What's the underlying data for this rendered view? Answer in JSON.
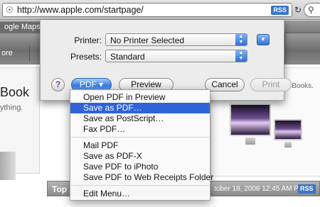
{
  "browser": {
    "url": "http://www.apple.com/startpage/",
    "rss_label": "RSS",
    "bookmarks": [
      "ogle Maps"
    ]
  },
  "page": {
    "nav_store": "ore",
    "left_title": "Book",
    "left_sub": "ything.",
    "promo_text": "precisely for the new MacBooks.",
    "top_sites_title": "Top S",
    "top_sites_date": "tober 18, 2008 12:45 AM PDT",
    "rss_label": "RSS"
  },
  "print_dialog": {
    "printer_label": "Printer:",
    "printer_value": "No Printer Selected",
    "presets_label": "Presets:",
    "presets_value": "Standard",
    "help_label": "?",
    "pdf_button": "PDF ▾",
    "preview_button": "Preview",
    "cancel_button": "Cancel",
    "print_button": "Print"
  },
  "pdf_menu": {
    "items": [
      "Open PDF in Preview",
      "Save as PDF…",
      "Save as PostScript…",
      "Fax PDF…",
      "Mail PDF",
      "Save as PDF-X",
      "Save PDF to iPhoto",
      "Save PDF to Web Receipts Folder",
      "Edit Menu…"
    ],
    "selected_index": 1
  },
  "colors": {
    "selection": "#2f63d8",
    "accent_blue": "#3a7ee0",
    "rss_blue": "#3b74c9"
  }
}
